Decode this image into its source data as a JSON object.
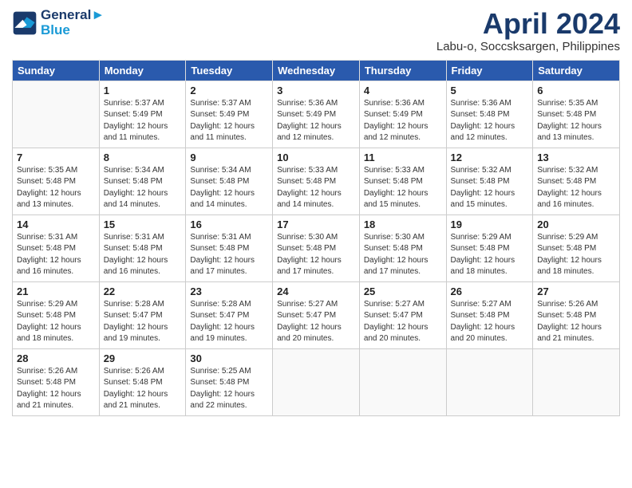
{
  "header": {
    "logo_line1": "General",
    "logo_line2": "Blue",
    "title": "April 2024",
    "subtitle": "Labu-o, Soccsksargen, Philippines"
  },
  "weekdays": [
    "Sunday",
    "Monday",
    "Tuesday",
    "Wednesday",
    "Thursday",
    "Friday",
    "Saturday"
  ],
  "weeks": [
    [
      {
        "day": "",
        "info": ""
      },
      {
        "day": "1",
        "info": "Sunrise: 5:37 AM\nSunset: 5:49 PM\nDaylight: 12 hours\nand 11 minutes."
      },
      {
        "day": "2",
        "info": "Sunrise: 5:37 AM\nSunset: 5:49 PM\nDaylight: 12 hours\nand 11 minutes."
      },
      {
        "day": "3",
        "info": "Sunrise: 5:36 AM\nSunset: 5:49 PM\nDaylight: 12 hours\nand 12 minutes."
      },
      {
        "day": "4",
        "info": "Sunrise: 5:36 AM\nSunset: 5:49 PM\nDaylight: 12 hours\nand 12 minutes."
      },
      {
        "day": "5",
        "info": "Sunrise: 5:36 AM\nSunset: 5:48 PM\nDaylight: 12 hours\nand 12 minutes."
      },
      {
        "day": "6",
        "info": "Sunrise: 5:35 AM\nSunset: 5:48 PM\nDaylight: 12 hours\nand 13 minutes."
      }
    ],
    [
      {
        "day": "7",
        "info": "Sunrise: 5:35 AM\nSunset: 5:48 PM\nDaylight: 12 hours\nand 13 minutes."
      },
      {
        "day": "8",
        "info": "Sunrise: 5:34 AM\nSunset: 5:48 PM\nDaylight: 12 hours\nand 14 minutes."
      },
      {
        "day": "9",
        "info": "Sunrise: 5:34 AM\nSunset: 5:48 PM\nDaylight: 12 hours\nand 14 minutes."
      },
      {
        "day": "10",
        "info": "Sunrise: 5:33 AM\nSunset: 5:48 PM\nDaylight: 12 hours\nand 14 minutes."
      },
      {
        "day": "11",
        "info": "Sunrise: 5:33 AM\nSunset: 5:48 PM\nDaylight: 12 hours\nand 15 minutes."
      },
      {
        "day": "12",
        "info": "Sunrise: 5:32 AM\nSunset: 5:48 PM\nDaylight: 12 hours\nand 15 minutes."
      },
      {
        "day": "13",
        "info": "Sunrise: 5:32 AM\nSunset: 5:48 PM\nDaylight: 12 hours\nand 16 minutes."
      }
    ],
    [
      {
        "day": "14",
        "info": "Sunrise: 5:31 AM\nSunset: 5:48 PM\nDaylight: 12 hours\nand 16 minutes."
      },
      {
        "day": "15",
        "info": "Sunrise: 5:31 AM\nSunset: 5:48 PM\nDaylight: 12 hours\nand 16 minutes."
      },
      {
        "day": "16",
        "info": "Sunrise: 5:31 AM\nSunset: 5:48 PM\nDaylight: 12 hours\nand 17 minutes."
      },
      {
        "day": "17",
        "info": "Sunrise: 5:30 AM\nSunset: 5:48 PM\nDaylight: 12 hours\nand 17 minutes."
      },
      {
        "day": "18",
        "info": "Sunrise: 5:30 AM\nSunset: 5:48 PM\nDaylight: 12 hours\nand 17 minutes."
      },
      {
        "day": "19",
        "info": "Sunrise: 5:29 AM\nSunset: 5:48 PM\nDaylight: 12 hours\nand 18 minutes."
      },
      {
        "day": "20",
        "info": "Sunrise: 5:29 AM\nSunset: 5:48 PM\nDaylight: 12 hours\nand 18 minutes."
      }
    ],
    [
      {
        "day": "21",
        "info": "Sunrise: 5:29 AM\nSunset: 5:48 PM\nDaylight: 12 hours\nand 18 minutes."
      },
      {
        "day": "22",
        "info": "Sunrise: 5:28 AM\nSunset: 5:47 PM\nDaylight: 12 hours\nand 19 minutes."
      },
      {
        "day": "23",
        "info": "Sunrise: 5:28 AM\nSunset: 5:47 PM\nDaylight: 12 hours\nand 19 minutes."
      },
      {
        "day": "24",
        "info": "Sunrise: 5:27 AM\nSunset: 5:47 PM\nDaylight: 12 hours\nand 20 minutes."
      },
      {
        "day": "25",
        "info": "Sunrise: 5:27 AM\nSunset: 5:47 PM\nDaylight: 12 hours\nand 20 minutes."
      },
      {
        "day": "26",
        "info": "Sunrise: 5:27 AM\nSunset: 5:48 PM\nDaylight: 12 hours\nand 20 minutes."
      },
      {
        "day": "27",
        "info": "Sunrise: 5:26 AM\nSunset: 5:48 PM\nDaylight: 12 hours\nand 21 minutes."
      }
    ],
    [
      {
        "day": "28",
        "info": "Sunrise: 5:26 AM\nSunset: 5:48 PM\nDaylight: 12 hours\nand 21 minutes."
      },
      {
        "day": "29",
        "info": "Sunrise: 5:26 AM\nSunset: 5:48 PM\nDaylight: 12 hours\nand 21 minutes."
      },
      {
        "day": "30",
        "info": "Sunrise: 5:25 AM\nSunset: 5:48 PM\nDaylight: 12 hours\nand 22 minutes."
      },
      {
        "day": "",
        "info": ""
      },
      {
        "day": "",
        "info": ""
      },
      {
        "day": "",
        "info": ""
      },
      {
        "day": "",
        "info": ""
      }
    ]
  ]
}
